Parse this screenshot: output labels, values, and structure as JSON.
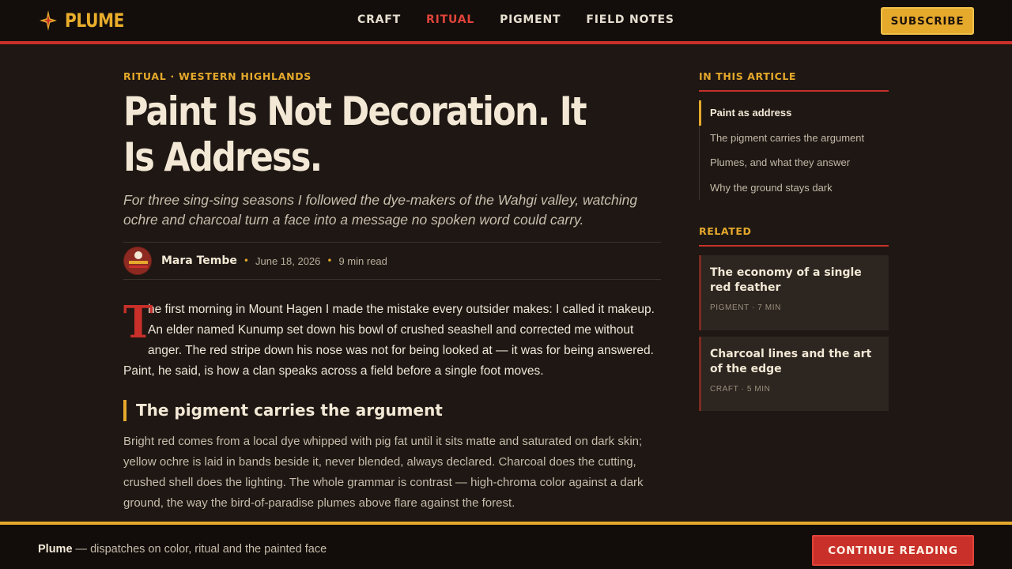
{
  "header": {
    "brand": "PLUME",
    "brand_icon": "star-burst-icon",
    "nav": [
      {
        "label": "CRAFT",
        "active": false
      },
      {
        "label": "RITUAL",
        "active": true
      },
      {
        "label": "PIGMENT",
        "active": false
      },
      {
        "label": "FIELD NOTES",
        "active": false
      }
    ],
    "subscribe_label": "SUBSCRIBE"
  },
  "article": {
    "kicker": "RITUAL · WESTERN HIGHLANDS",
    "title": "Paint Is Not Decoration. It Is Address.",
    "dek": "For three sing-sing seasons I followed the dye-makers of the Wahgi valley, watching ochre and charcoal turn a face into a message no spoken word could carry.",
    "author": "Mara Tembe",
    "date": "June 18, 2026",
    "read_time": "9 min read",
    "dropcap": "T",
    "lede": "he first morning in Mount Hagen I made the mistake every outsider makes: I called it makeup. An elder named Kunump set down his bowl of crushed seashell and corrected me without anger. The red stripe down his nose was not for being looked at — it was for being answered. Paint, he said, is how a clan speaks across a field before a single foot moves.",
    "section_heading": "The pigment carries the argument",
    "section_body": "Bright red comes from a local dye whipped with pig fat until it sits matte and saturated on dark skin; yellow ochre is laid in bands beside it, never blended, always declared. Charcoal does the cutting, crushed shell does the lighting. The whole grammar is contrast — high-chroma color against a dark ground, the way the bird-of-paradise plumes above flare against the forest."
  },
  "sidebar": {
    "toc_heading": "IN THIS ARTICLE",
    "toc": [
      {
        "label": "Paint as address",
        "active": true
      },
      {
        "label": "The pigment carries the argument",
        "active": false
      },
      {
        "label": "Plumes, and what they answer",
        "active": false
      },
      {
        "label": "Why the ground stays dark",
        "active": false
      }
    ],
    "related_heading": "RELATED",
    "related": [
      {
        "title": "The economy of a single red feather",
        "meta": "PIGMENT · 7 MIN"
      },
      {
        "title": "Charcoal lines and the art of the edge",
        "meta": "CRAFT · 5 MIN"
      }
    ]
  },
  "footer": {
    "brand": "Plume",
    "tagline": " — dispatches on color, ritual and the painted face",
    "cta_label": "CONTINUE READING"
  },
  "colors": {
    "background": "#1e1713",
    "accent_red": "#c9302a",
    "accent_yellow": "#e5a92c",
    "text": "#efe6d8"
  }
}
